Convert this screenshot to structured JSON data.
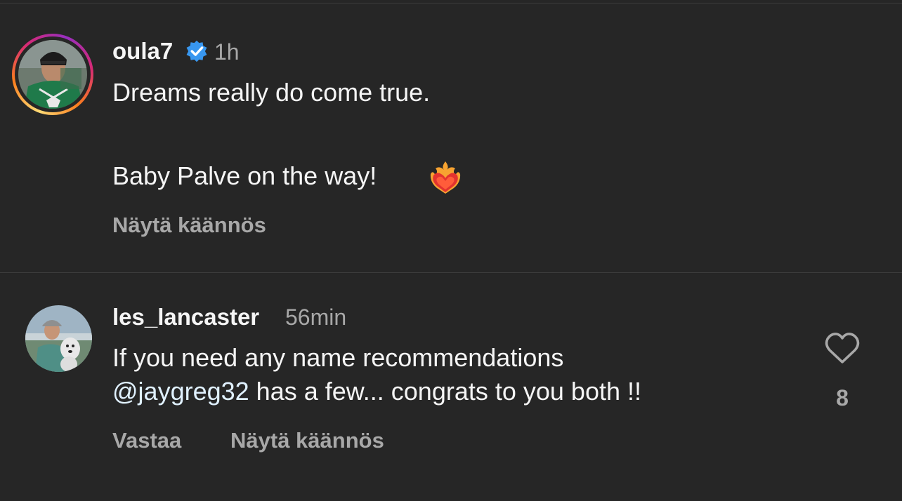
{
  "post": {
    "username": "oula7",
    "time": "1h",
    "caption_line1": "Dreams really do come true.",
    "caption_line2": "Baby Palve on the way!",
    "translate_label": "Näytä käännös",
    "verified_icon": "verified-badge-icon",
    "emoji_icon": "heart-on-fire-icon"
  },
  "comment": {
    "username": "les_lancaster",
    "time": "56min",
    "text_line1": "If you need any name recommendations",
    "mention": "@jaygreg32",
    "text_line2_rest": " has a few... congrats to you both !!",
    "reply_label": "Vastaa",
    "translate_label": "Näytä käännös",
    "like_count": "8",
    "like_icon": "heart-outline-icon"
  },
  "colors": {
    "background": "#262626",
    "primary_text": "#f5f5f5",
    "secondary_text": "#a8a8a8",
    "mention": "#e0f1ff",
    "verified": "#3897f0"
  }
}
